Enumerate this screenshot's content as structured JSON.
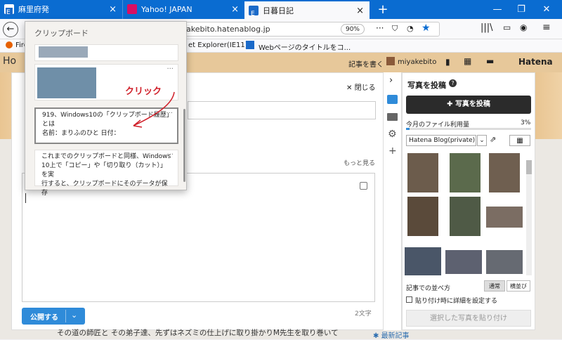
{
  "tabs": [
    {
      "label": "麻里府発",
      "close": "×"
    },
    {
      "label": "Yahoo! JAPAN",
      "close": "×"
    },
    {
      "label": "日暮日記",
      "close": "×"
    }
  ],
  "new_tab": "+",
  "window_buttons": {
    "minimize": "—",
    "restore": "❐",
    "close": "✕"
  },
  "url": {
    "value": "akebito.hatenablog.jp",
    "zoom": "90%"
  },
  "bookmarks": [
    {
      "label": "Fire"
    },
    {
      "label": "et Explorer(IE11)..."
    },
    {
      "label": "Webページのタイトルをコ..."
    }
  ],
  "hatena": {
    "left_label": "Ho",
    "write_article": "記事を書く",
    "username": "miyakebito",
    "logo": "Hatena"
  },
  "editor": {
    "close_label": "閉じる",
    "more_label": "もっと見る",
    "char_count": "2文字",
    "publish_label": "公開する",
    "bottom_text": "その道の師匠と その弟子達、先ずはネズミの仕上げに取り掛かりM先生を取り巻いて"
  },
  "clipboard": {
    "title": "クリップボード",
    "annotation": "クリック",
    "items": [
      {
        "text_line1": "919、Windows10の「クリップボード履歴」",
        "text_line2": "とは",
        "text_line3": "名前：まりふのひと 日付："
      },
      {
        "text_line1": "これまでのクリップボードと同様、Windows",
        "text_line2": "10上で「コピー」や「切り取り（カット）」を実",
        "text_line3": "行すると、クリップボードにそのデータが保存"
      }
    ],
    "more": "···"
  },
  "photo_panel": {
    "title": "写真を投稿",
    "help": "?",
    "upload_button": "写真を投稿",
    "usage_label": "今月のファイル利用量",
    "usage_percent": "3%",
    "usage_fraction": 0.03,
    "album_select": "Hatena Blog(private)",
    "sort_label": "記事での並べ方",
    "sort_options": [
      "通常",
      "横並び"
    ],
    "detail_checkbox_label": "貼り付け時に詳細を設定する",
    "paste_button": "選択した写真を貼り付け",
    "latest_articles": "最新記事"
  },
  "colors": {
    "tabbar": "#0a6cd1",
    "accent": "#2f8bd9",
    "annotation": "#d0202a",
    "dark_button": "#2b2b2b"
  }
}
